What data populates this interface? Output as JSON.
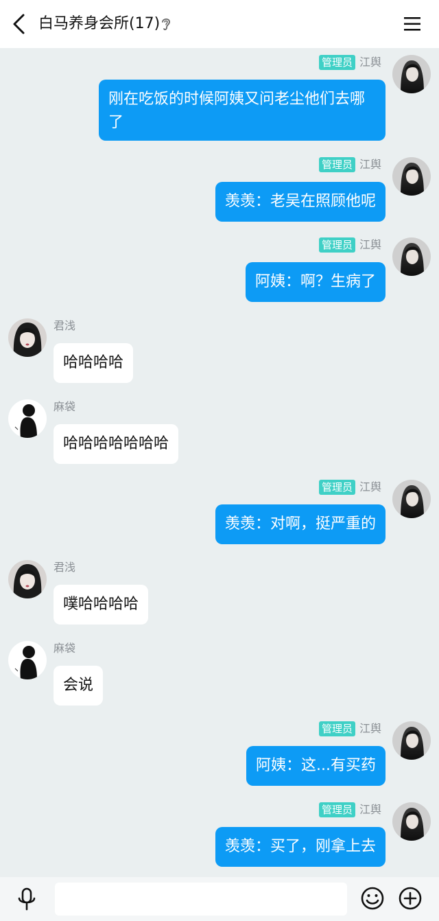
{
  "header": {
    "title": "白马养身会所(17)",
    "back_icon": "chevron-left-icon",
    "ear_icon": "ear-icon",
    "menu_icon": "hamburger-menu-icon"
  },
  "colors": {
    "outgoing_bubble": "#0d9bf5",
    "admin_badge": "#3fd0c6",
    "background": "#eaeff0"
  },
  "messages": [
    {
      "side": "out",
      "name": "江舆",
      "badge": "管理员",
      "text": "刚在吃饭的时候阿姨又问老尘他们去哪了"
    },
    {
      "side": "out",
      "name": "江舆",
      "badge": "管理员",
      "text": "羡羡：老吴在照顾他呢"
    },
    {
      "side": "out",
      "name": "江舆",
      "badge": "管理员",
      "text": "阿姨：啊？生病了"
    },
    {
      "side": "in",
      "name": "君浅",
      "text": "哈哈哈哈"
    },
    {
      "side": "in",
      "name": "麻袋",
      "text": "哈哈哈哈哈哈哈"
    },
    {
      "side": "out",
      "name": "江舆",
      "badge": "管理员",
      "text": "羡羡：对啊，挺严重的"
    },
    {
      "side": "in",
      "name": "君浅",
      "text": "噗哈哈哈哈"
    },
    {
      "side": "in",
      "name": "麻袋",
      "text": "会说"
    },
    {
      "side": "out",
      "name": "江舆",
      "badge": "管理员",
      "text": "阿姨：这...有买药"
    },
    {
      "side": "out",
      "name": "江舆",
      "badge": "管理员",
      "text": "羡羡：买了，刚拿上去"
    }
  ],
  "bottom_bar": {
    "input_value": "",
    "mic_icon": "microphone-icon",
    "emoji_icon": "emoji-icon",
    "plus_icon": "plus-icon"
  }
}
